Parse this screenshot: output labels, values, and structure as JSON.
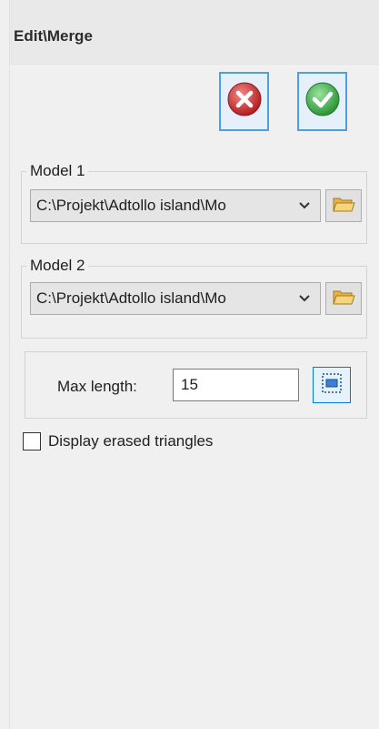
{
  "header": {
    "title": "Edit\\Merge"
  },
  "actions": {
    "cancel_icon": "cancel-icon",
    "ok_icon": "ok-icon"
  },
  "model1": {
    "legend": "Model 1",
    "path": "C:\\Projekt\\Adtollo island\\Mo",
    "dropdown_icon": "chevron-down-icon",
    "browse_icon": "folder-icon"
  },
  "model2": {
    "legend": "Model 2",
    "path": "C:\\Projekt\\Adtollo island\\Mo",
    "dropdown_icon": "chevron-down-icon",
    "browse_icon": "folder-icon"
  },
  "max_length": {
    "label": "Max length:",
    "value": "15",
    "select_icon": "select-area-icon"
  },
  "display_erased": {
    "label": "Display erased triangles",
    "checked": false
  },
  "colors": {
    "accent": "#4a9fe6",
    "cancel_red": "#d63a3a",
    "ok_green": "#3cb04a"
  }
}
